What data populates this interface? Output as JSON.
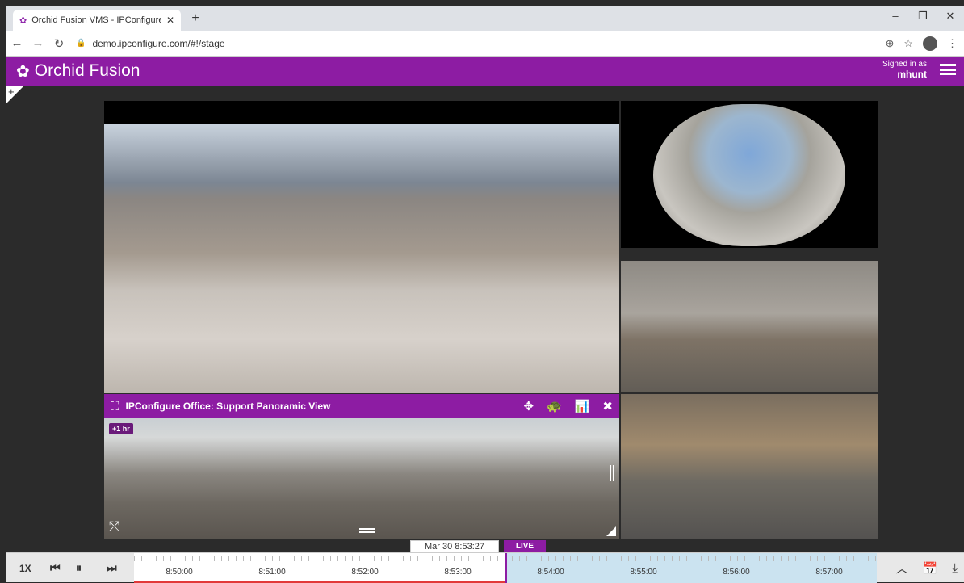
{
  "browser": {
    "tab_title": "Orchid Fusion VMS - IPConfigure",
    "tab_close": "✕",
    "new_tab": "+",
    "url": "demo.ipconfigure.com/#!/stage",
    "minimize": "–",
    "maximize": "❐",
    "close": "✕"
  },
  "app": {
    "logo_text": "Orchid Fusion",
    "signed_in_label": "Signed in as",
    "username": "mhunt"
  },
  "tiles": {
    "panoramic": {
      "title": "IPConfigure Office: Support Panoramic View",
      "badge": "+1 hr"
    }
  },
  "timeline": {
    "speed": "1X",
    "current_time": "Mar 30 8:53:27",
    "live_label": "LIVE",
    "tick_labels": [
      "8:50:00",
      "8:51:00",
      "8:52:00",
      "8:53:00",
      "8:54:00",
      "8:55:00",
      "8:56:00",
      "8:57:00"
    ]
  },
  "colors": {
    "brand": "#8d1ca3",
    "future_track": "#cbe3f0",
    "recorded": "#e23a3a"
  },
  "icons": {
    "back": "arrow-left-icon",
    "forward": "arrow-right-icon",
    "reload": "reload-icon",
    "zoom": "zoom-icon",
    "star": "star-icon",
    "menu": "hamburger-icon",
    "expand": "expand-icon",
    "ptz": "move-icon",
    "turtle": "turtle-icon",
    "stats": "bar-chart-icon",
    "close": "close-icon",
    "calendar": "calendar-icon",
    "download": "download-icon"
  }
}
